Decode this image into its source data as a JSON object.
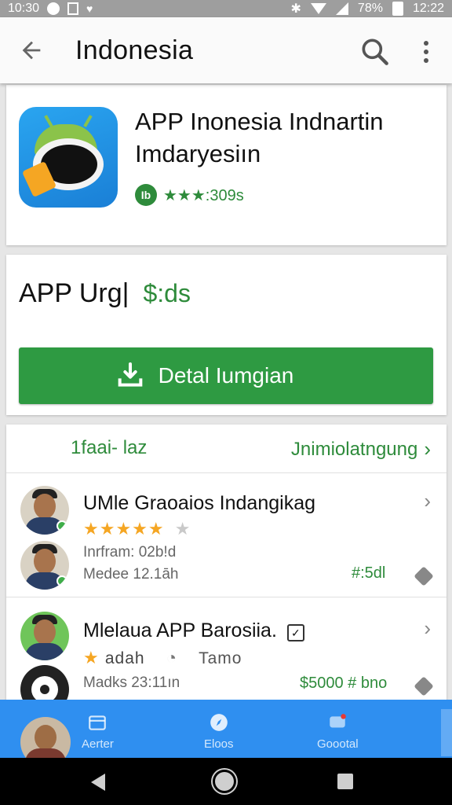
{
  "status_bar": {
    "time_left": "10:30",
    "battery": "78%",
    "time_right": "12:22"
  },
  "app_bar": {
    "title": "Indonesia",
    "back_icon": "arrow-left-icon",
    "search_icon": "search-icon",
    "more_icon": "more-vert-icon"
  },
  "app_card": {
    "title": "APP Inonesia Indnartin Imdaryesiın",
    "rating_text": "★★★:309s",
    "rating_badge": "Ib"
  },
  "price_card": {
    "label": "APP Urg|",
    "value": "$:ds",
    "install_label": "Detal Iumgian",
    "download_icon": "download-icon"
  },
  "reviews_section": {
    "header_left": "1faai- laz",
    "header_right": "Jnimiolatngung",
    "reviews": [
      {
        "name": "UMle Graoaios Indangikag",
        "stars": "★★★★★",
        "stars_off": "★",
        "meta1": "Inrfram: 02b!d",
        "meta2": "Medee 12.1āh",
        "right_value": "#:5dl"
      },
      {
        "name": "Mlelaua APP Barosiia.",
        "stars": "★",
        "star_text": "adah",
        "tag_text": "Tamo",
        "meta2": "Madks 23:11ın",
        "right_value": "$5000 # bno"
      }
    ]
  },
  "bottom_nav": {
    "items": [
      {
        "label": "Aerter",
        "icon": "calendar-icon"
      },
      {
        "label": "Eloos",
        "icon": "compass-icon"
      },
      {
        "label": "Goootal",
        "icon": "chat-icon"
      }
    ]
  },
  "colors": {
    "accent_green": "#2e9a42",
    "nav_blue": "#2f8ff0",
    "star_gold": "#f5a623"
  }
}
